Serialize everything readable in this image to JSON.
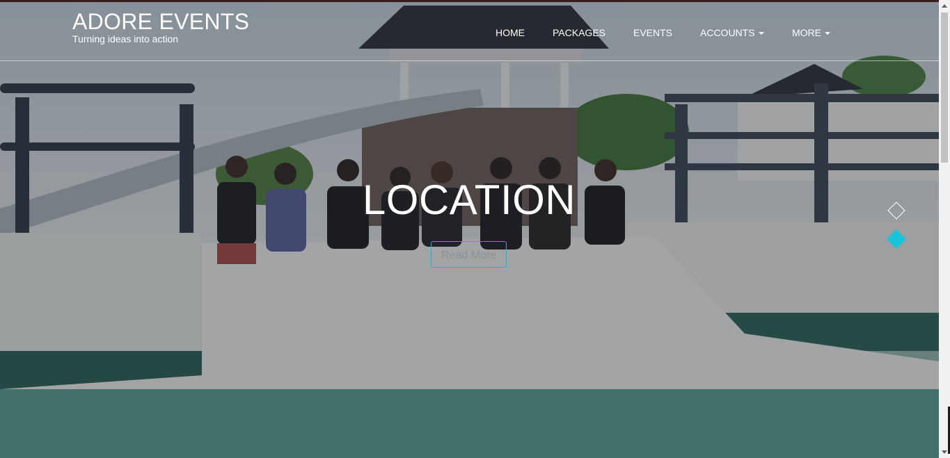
{
  "brand": {
    "title": "ADORE EVENTS",
    "tagline": "Turning ideas into action"
  },
  "nav": {
    "items": [
      {
        "label": "HOME",
        "has_caret": false
      },
      {
        "label": "PACKAGES",
        "has_caret": false
      },
      {
        "label": "EVENTS",
        "has_caret": false
      },
      {
        "label": "ACCOUNTS",
        "has_caret": true
      },
      {
        "label": "MORE",
        "has_caret": true
      }
    ]
  },
  "hero": {
    "title": "LOCATION",
    "button_label": "Read More"
  },
  "carousel": {
    "slide_count": 2,
    "active_slide": 2
  },
  "colors": {
    "accent": "#1cc4d9",
    "button_border": "#1fb3c4",
    "text": "#ffffff"
  },
  "icons": {
    "caret": "caret-down-icon",
    "indicator": "diamond-indicator-icon"
  }
}
